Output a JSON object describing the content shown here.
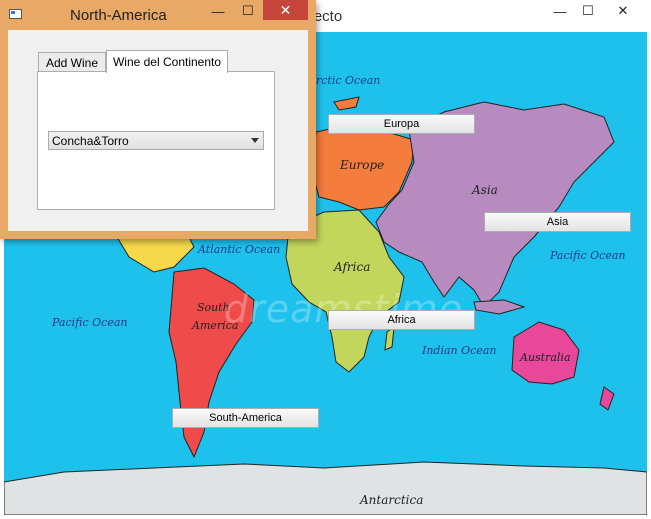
{
  "main_window": {
    "title_fragment": "oyecto",
    "minimize": "—",
    "maximize": "☐",
    "close": "✕"
  },
  "map": {
    "labels": {
      "arctic": "rctic Ocean",
      "europe": "Europe",
      "asia": "Asia",
      "africa": "Africa",
      "south_america_1": "South",
      "south_america_2": "America",
      "australia": "Australia",
      "atlantic": "Atlantic Ocean",
      "pacific_left": "Pacific Ocean",
      "pacific_right": "Pacific Ocean",
      "indian": "Indian Ocean",
      "antarctica": "Antarctica"
    },
    "watermark": "dreamstime",
    "colors": {
      "ocean": "#1ec1ec",
      "europe": "#f47c3c",
      "asia": "#b78bc0",
      "africa": "#c3d65c",
      "south_america": "#ef4b4b",
      "north_america": "#f6d94a",
      "australia": "#e8479a",
      "antarctica": "#dfe3e3"
    }
  },
  "buttons": {
    "europa": "Europa",
    "asia": "Asia",
    "africa": "Africa",
    "south_america": "South-America"
  },
  "child_window": {
    "title": "North-America",
    "minimize": "—",
    "maximize": "☐",
    "close": "✕",
    "tabs": [
      "Add Wine",
      "Wine del Continento"
    ],
    "active_tab": "Wine del Continento",
    "combo_value": "Concha&Torro"
  }
}
